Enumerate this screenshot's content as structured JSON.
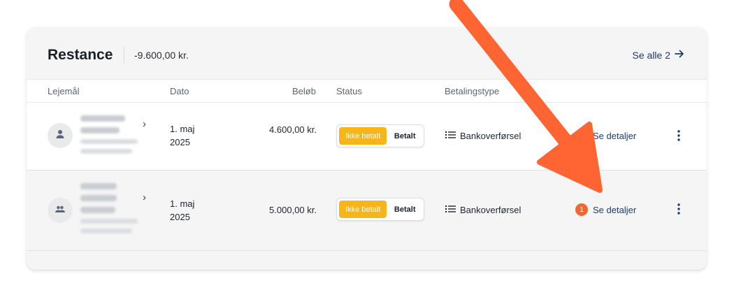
{
  "card": {
    "title": "Restance",
    "total": "-9.600,00 kr.",
    "see_all_label": "Se alle 2"
  },
  "table": {
    "columns": [
      "Lejemål",
      "Dato",
      "Beløb",
      "Status",
      "Betalingstype"
    ],
    "rows": [
      {
        "date_line1": "1. maj",
        "date_line2": "2025",
        "amount": "4.600,00 kr.",
        "status_unpaid": "Ikke betalt",
        "status_paid": "Betalt",
        "payment_type": "Bankoverførsel",
        "details_label": "Se detaljer",
        "avatar_icon": "person-icon"
      },
      {
        "date_line1": "1. maj",
        "date_line2": "2025",
        "amount": "5.000,00 kr.",
        "status_unpaid": "Ikke betalt",
        "status_paid": "Betalt",
        "payment_type": "Bankoverførsel",
        "details_label": "Se detaljer",
        "badge_count": "1",
        "avatar_icon": "group-icon"
      }
    ]
  },
  "colors": {
    "accent_navy": "#1e3a6e",
    "status_yellow": "#f7b51a",
    "badge_orange": "#f26730",
    "arrow_orange": "#ff6433"
  }
}
